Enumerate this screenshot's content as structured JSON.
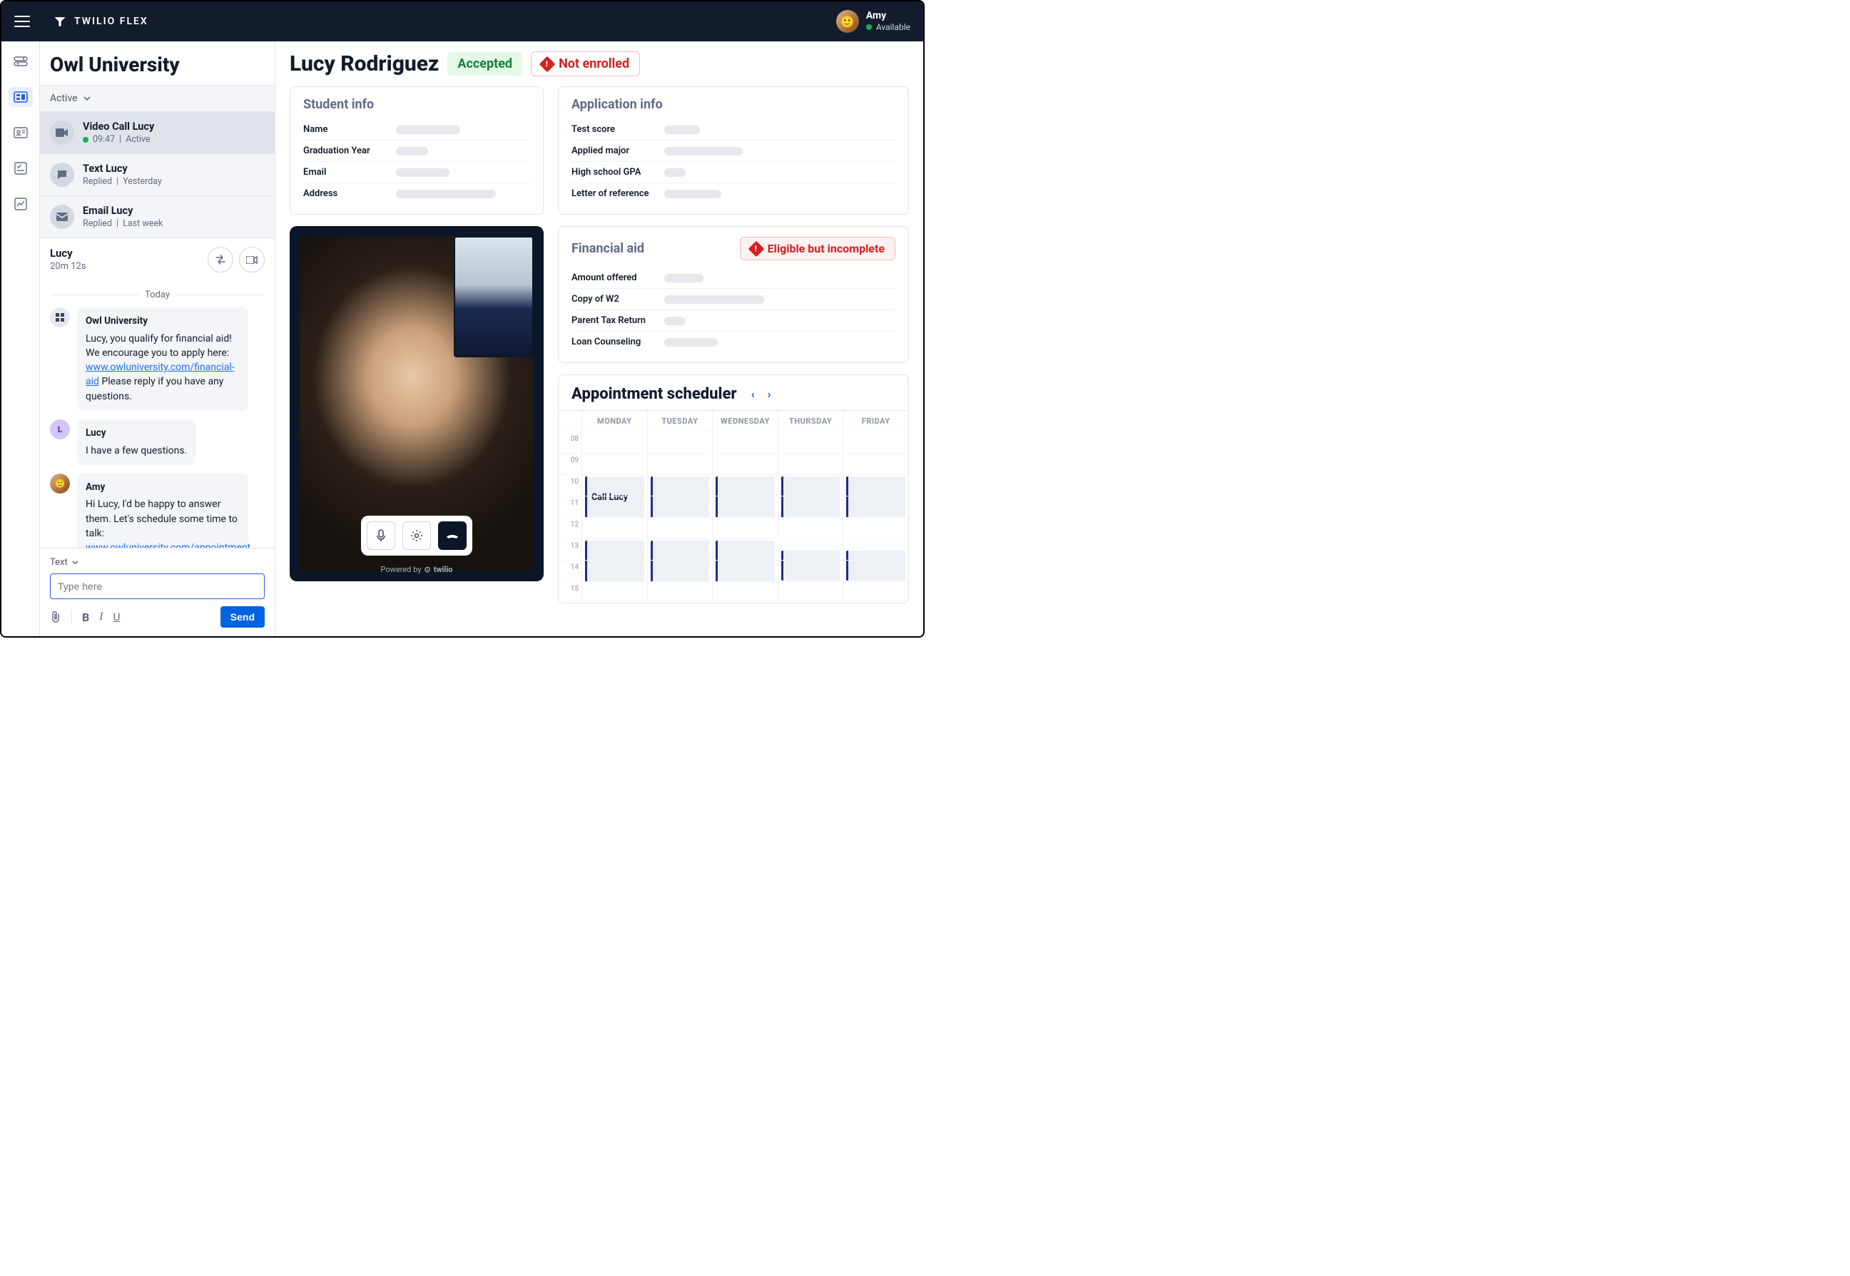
{
  "brand": "TWILIO FLEX",
  "user": {
    "name": "Amy",
    "status": "Available"
  },
  "org_title": "Owl University",
  "filter_label": "Active",
  "tasks": [
    {
      "title": "Video Call Lucy",
      "meta_time": "09:47",
      "meta_status": "Active",
      "live": true
    },
    {
      "title": "Text Lucy",
      "meta_status": "Replied",
      "meta_when": "Yesterday"
    },
    {
      "title": "Email Lucy",
      "meta_status": "Replied",
      "meta_when": "Last week"
    }
  ],
  "conversation": {
    "title": "Lucy",
    "duration": "20m 12s",
    "day_label": "Today",
    "messages": {
      "m0": {
        "sender": "Owl University",
        "text_a": "Lucy, you qualify for financial aid! We encourage you to apply here: ",
        "link_a": "www.owluniversity.com/financial-aid",
        "text_b": " Please reply if you have any questions."
      },
      "m1": {
        "sender": "Lucy",
        "text": "I have a few questions."
      },
      "m2": {
        "sender": "Amy",
        "text_a": "Hi Lucy, I'd be happy to answer them. Let's schedule some time to talk: ",
        "link_a": "www.owluniversity.com/appointment"
      }
    },
    "composer_mode": "Text",
    "placeholder": "Type here",
    "send": "Send"
  },
  "student": {
    "name": "Lucy Rodriguez",
    "status_accepted": "Accepted",
    "status_enrolled": "Not enrolled"
  },
  "cards": {
    "student_info": {
      "title": "Student info",
      "rows": [
        "Name",
        "Graduation Year",
        "Email",
        "Address"
      ]
    },
    "application_info": {
      "title": "Application info",
      "rows": [
        "Test score",
        "Applied major",
        "High school GPA",
        "Letter of reference"
      ]
    },
    "financial_aid": {
      "title": "Financial aid",
      "badge": "Eligible but incomplete",
      "rows": [
        "Amount offered",
        "Copy of W2",
        "Parent Tax Return",
        "Loan Counseling"
      ]
    }
  },
  "video": {
    "powered": "Powered by",
    "powered_brand": "twilio"
  },
  "scheduler": {
    "title": "Appointment scheduler",
    "days": [
      "MONDAY",
      "TUESDAY",
      "WEDNESDAY",
      "THURSDAY",
      "FRIDAY"
    ],
    "hours": [
      "08",
      "09",
      "10",
      "11",
      "12",
      "13",
      "14",
      "15"
    ],
    "event_label": "Call Lucy"
  }
}
